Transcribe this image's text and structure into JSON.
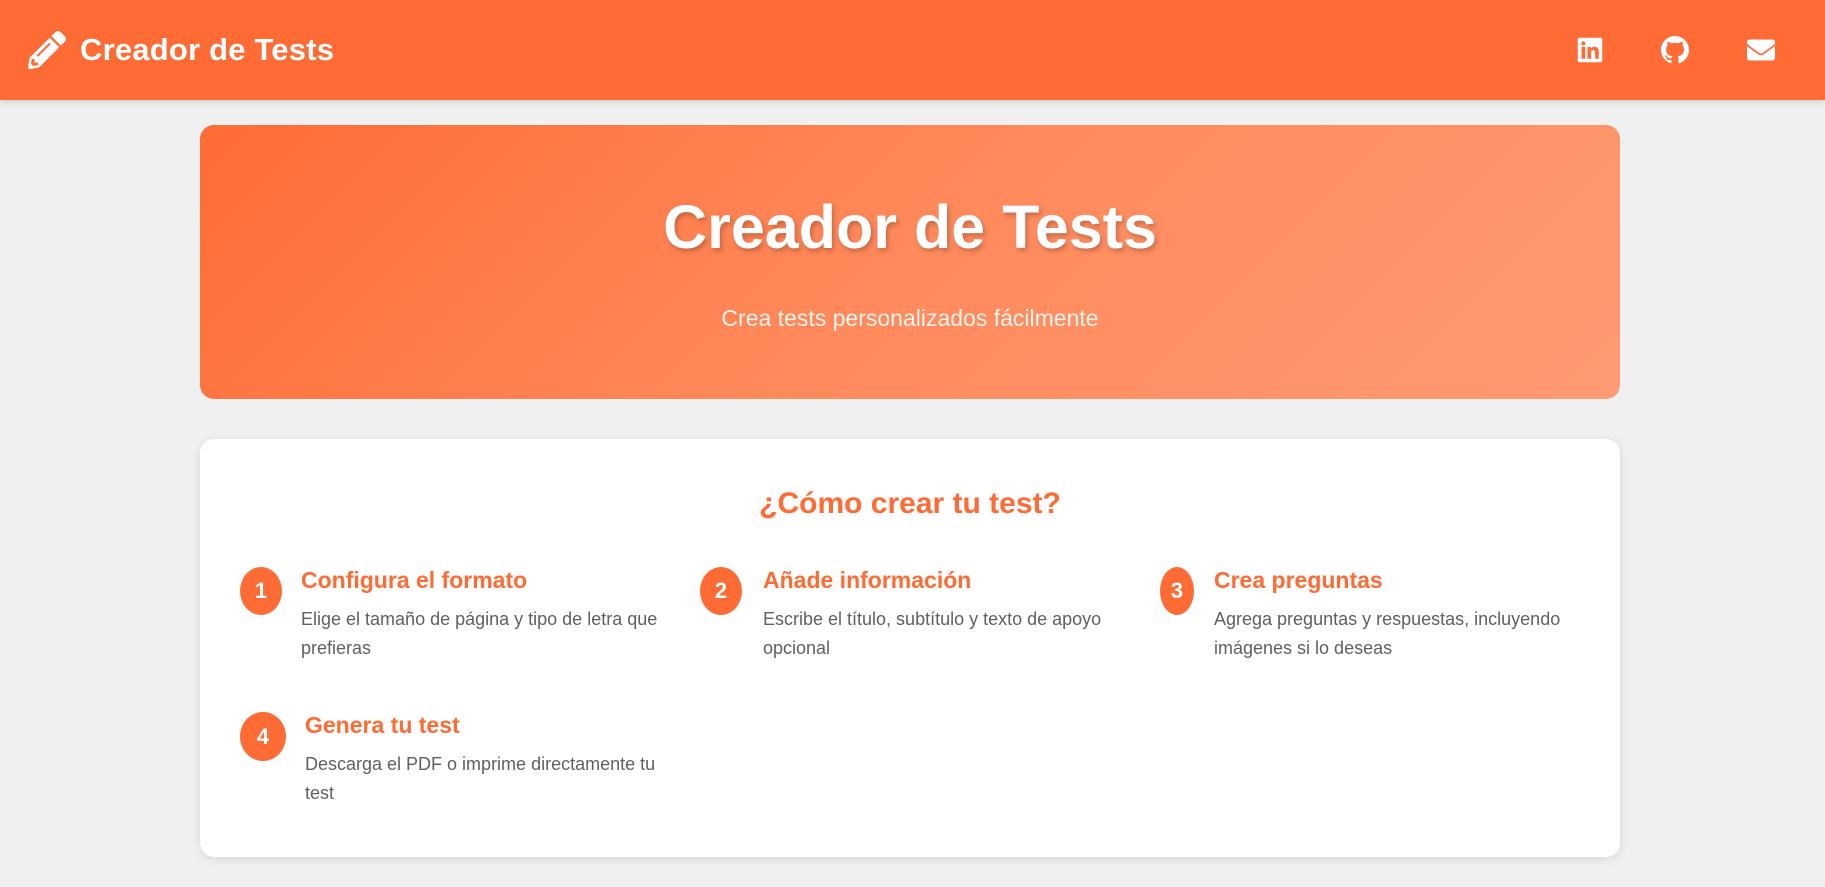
{
  "header": {
    "brand_icon": "pencil-icon",
    "brand_title": "Creador de Tests",
    "social": [
      {
        "icon": "linkedin-icon"
      },
      {
        "icon": "github-icon"
      },
      {
        "icon": "envelope-icon"
      }
    ]
  },
  "hero": {
    "title": "Creador de Tests",
    "subtitle": "Crea tests personalizados fácilmente"
  },
  "how_to": {
    "title": "¿Cómo crear tu test?",
    "steps": [
      {
        "number": "1",
        "title": "Configura el formato",
        "description": "Elige el tamaño de página y tipo de letra que prefieras"
      },
      {
        "number": "2",
        "title": "Añade información",
        "description": "Escribe el título, subtítulo y texto de apoyo opcional"
      },
      {
        "number": "3",
        "title": "Crea preguntas",
        "description": "Agrega preguntas y respuestas, incluyendo imágenes si lo deseas"
      },
      {
        "number": "4",
        "title": "Genera tu test",
        "description": "Descarga el PDF o imprime directamente tu test"
      }
    ]
  },
  "colors": {
    "accent": "#ff6b35",
    "background": "#f0f0f0",
    "card": "#ffffff",
    "text_muted": "#606060"
  }
}
